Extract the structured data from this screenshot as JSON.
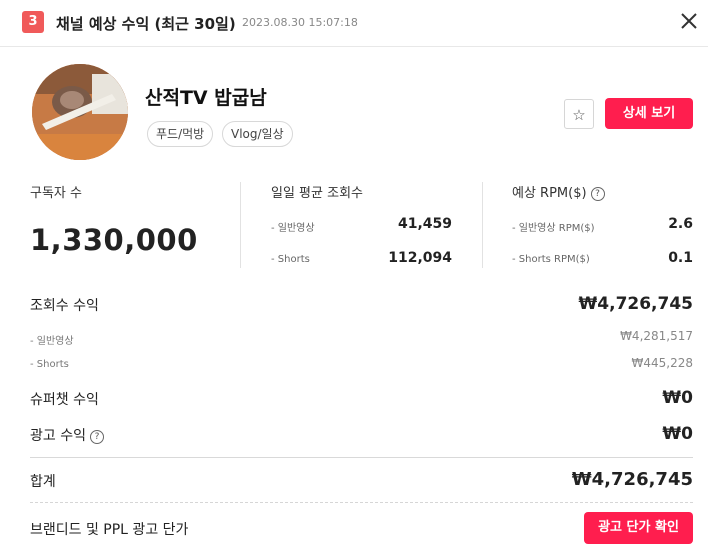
{
  "header": {
    "badge": "3",
    "title": "채널 예상 수익 (최근 30일)",
    "timestamp": "2023.08.30 15:07:18"
  },
  "channel": {
    "name": "산적TV 밥굽남",
    "tags": [
      "푸드/먹방",
      "Vlog/일상"
    ],
    "detail_button": "상세 보기"
  },
  "stats": {
    "subscribers_label": "구독자 수",
    "subscribers_value": "1,330,000",
    "views_label": "일일 평균 조회수",
    "views_rows": [
      {
        "label": "- 일반영상",
        "value": "41,459"
      },
      {
        "label": "- Shorts",
        "value": "112,094"
      }
    ],
    "rpm_label": "예상 RPM($)",
    "rpm_rows": [
      {
        "label": "- 일반영상 RPM($)",
        "value": "2.6"
      },
      {
        "label": "- Shorts RPM($)",
        "value": "0.1"
      }
    ]
  },
  "revenue": {
    "view_revenue_label": "조회수 수익",
    "view_revenue_value": "₩4,726,745",
    "sub_rows": [
      {
        "label": "- 일반영상",
        "value": "₩4,281,517"
      },
      {
        "label": "- Shorts",
        "value": "₩445,228"
      }
    ],
    "superchat_label": "슈퍼챗 수익",
    "superchat_value": "₩0",
    "ad_label": "광고 수익",
    "ad_value": "₩0",
    "total_label": "합계",
    "total_value": "₩4,726,745",
    "branded_label": "브랜디드 및 PPL 광고 단가",
    "branded_button": "광고 단가 확인"
  },
  "icons": {
    "close": "close-icon",
    "star": "star-icon",
    "help": "question-circle-icon"
  },
  "colors": {
    "accent": "#ff1e4e",
    "badge": "#f05a5a"
  }
}
